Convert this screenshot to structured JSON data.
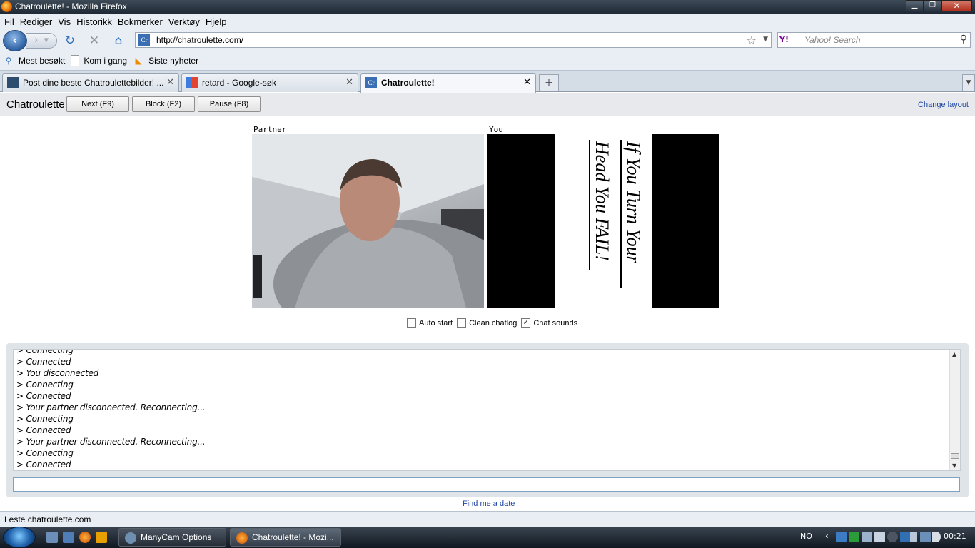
{
  "window": {
    "title": "Chatroulette! - Mozilla Firefox"
  },
  "menu": [
    "Fil",
    "Rediger",
    "Vis",
    "Historikk",
    "Bokmerker",
    "Verktøy",
    "Hjelp"
  ],
  "nav": {
    "url": "http://chatroulette.com/",
    "site_favicon": "Cr",
    "search_placeholder": "Yahoo! Search",
    "search_engine_icon": "Y!"
  },
  "bookmarks": [
    "Mest besøkt",
    "Kom i gang",
    "Siste nyheter"
  ],
  "tabs": [
    {
      "label": "Post dine beste Chatroulettebilder! ...",
      "active": false
    },
    {
      "label": "retard - Google-søk",
      "active": false
    },
    {
      "label": "Chatroulette!",
      "active": true
    }
  ],
  "site": {
    "brand": "Chatroulette",
    "buttons": {
      "next": "Next (F9)",
      "block": "Block (F2)",
      "pause": "Pause (F8)"
    },
    "change_layout": "Change layout",
    "partner_label": "Partner",
    "you_label": "You",
    "overlay_line1": "If You Turn Your",
    "overlay_line2": "Head You FAIL!",
    "options": [
      {
        "label": "Auto start",
        "checked": false
      },
      {
        "label": "Clean chatlog",
        "checked": false
      },
      {
        "label": "Chat sounds",
        "checked": true
      }
    ],
    "chatlog": [
      "> Connecting",
      "> Connected",
      "> You disconnected",
      "> Connecting",
      "> Connected",
      "> Your partner disconnected. Reconnecting...",
      "> Connecting",
      "> Connected",
      "> Your partner disconnected. Reconnecting...",
      "> Connecting",
      "> Connected"
    ],
    "find_date": "Find me a date"
  },
  "status": "Leste chatroulette.com",
  "taskbar": {
    "items": [
      {
        "label": "ManyCam Options",
        "active": false
      },
      {
        "label": "Chatroulette! - Mozi...",
        "active": true
      }
    ],
    "lang": "NO",
    "clock": "00:21"
  }
}
